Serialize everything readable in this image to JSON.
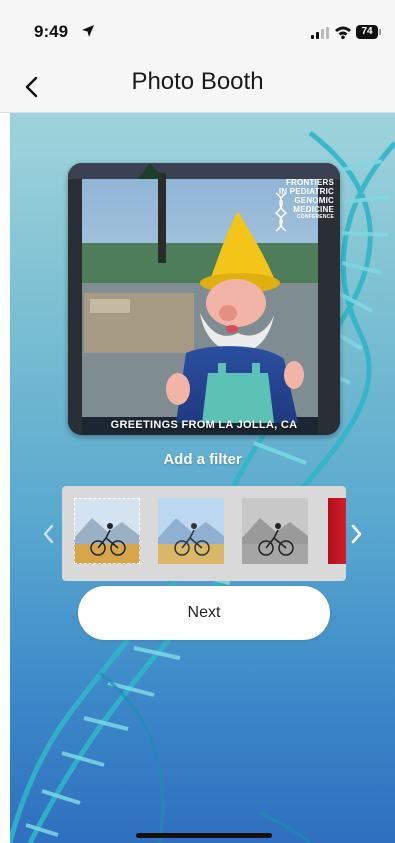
{
  "status_bar": {
    "time": "9:49",
    "battery": "74"
  },
  "nav": {
    "title": "Photo Booth"
  },
  "photo": {
    "logo_lines": [
      "FRONTIERS",
      "IN PEDIATRIC",
      "GENOMIC",
      "MEDICINE",
      "CONFERENCE"
    ],
    "caption": "GREETINGS FROM LA JOLLA, CA"
  },
  "filters": {
    "label": "Add a filter",
    "items": [
      {
        "name": "original",
        "selected": true
      },
      {
        "name": "cool",
        "selected": false
      },
      {
        "name": "grayscale",
        "selected": false
      },
      {
        "name": "red",
        "selected": false
      }
    ]
  },
  "actions": {
    "next_label": "Next"
  },
  "colors": {
    "background_top": "#9fd3dc",
    "background_bottom": "#2f6fbf",
    "gnome_hat": "#f2c518",
    "helix": "#2fb6c8"
  },
  "icons": [
    "location-arrow-icon",
    "signal-icon",
    "wifi-icon",
    "battery-icon",
    "back-chevron-icon",
    "chevron-left-icon",
    "chevron-right-icon",
    "dna-icon"
  ]
}
